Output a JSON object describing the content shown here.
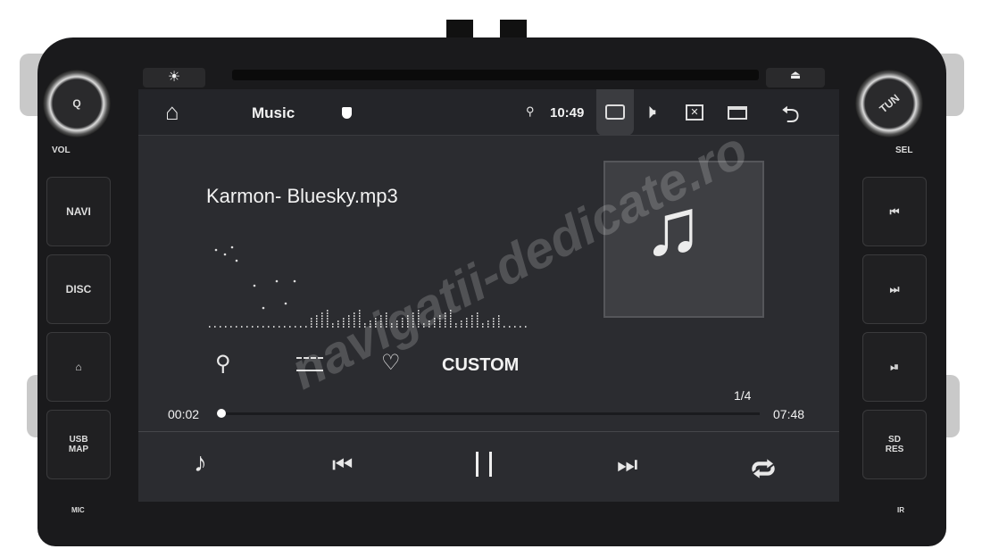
{
  "device": {
    "left_knob_label": "Q",
    "vol_label": "VOL",
    "right_knob_label": "TUN",
    "sel_label": "SEL",
    "left_buttons": [
      "NAVI",
      "DISC",
      "⌂",
      "USB MAP"
    ],
    "right_buttons": [
      "⏮",
      "⏭",
      "⏯",
      "SD RES"
    ],
    "mic_label": "MIC",
    "ir_label": "IR",
    "eject_icon": "eject-icon",
    "brightness_icon": "sun-icon"
  },
  "status_bar": {
    "title": "Music",
    "time": "10:49",
    "icons": [
      "home-icon",
      "shield-icon",
      "location-icon",
      "camera-icon",
      "volume-icon",
      "close-app-icon",
      "recent-apps-icon",
      "back-icon"
    ]
  },
  "player": {
    "track_title": "Karmon- Bluesky.mp3",
    "eq_preset": "CUSTOM",
    "elapsed": "00:02",
    "total": "07:48",
    "track_index": "1/4",
    "progress_fraction": 0.004,
    "controls": [
      "playlist-icon",
      "previous-icon",
      "pause-icon",
      "next-icon",
      "repeat-icon"
    ]
  },
  "watermark": "navigatii-dedicate.ro"
}
